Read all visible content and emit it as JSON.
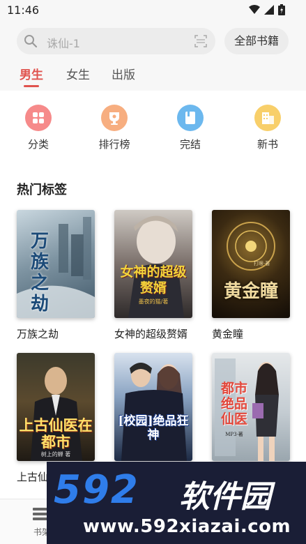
{
  "status_bar": {
    "time": "11:46"
  },
  "search": {
    "placeholder": "诛仙-1"
  },
  "header": {
    "all_books_label": "全部书籍"
  },
  "tabs": [
    {
      "label": "男生",
      "active": true
    },
    {
      "label": "女生",
      "active": false
    },
    {
      "label": "出版",
      "active": false
    }
  ],
  "categories": [
    {
      "label": "分类",
      "icon": "grid-icon",
      "color": "#f26b6b"
    },
    {
      "label": "排行榜",
      "icon": "trophy-icon",
      "color": "#f5a366"
    },
    {
      "label": "完结",
      "icon": "book-icon",
      "color": "#4aa3e8"
    },
    {
      "label": "新书",
      "icon": "building-icon",
      "color": "#f5c247"
    }
  ],
  "section": {
    "title": "热门标签"
  },
  "books": [
    {
      "title": "万族之劫",
      "cover_text": "万族之劫",
      "author_text": ""
    },
    {
      "title": "女神的超级赘婿",
      "cover_text": "女神的超级赘婿",
      "author_text": "墨夜的猫/著"
    },
    {
      "title": "黄金瞳",
      "cover_text": "黄金瞳",
      "author_text": "打眼·著"
    },
    {
      "title": "上古仙",
      "cover_text": "上古仙医在都市",
      "author_text": "树上的蝉 著"
    },
    {
      "title": "",
      "cover_text": "[校园]绝品狂神",
      "author_text": ""
    },
    {
      "title": "",
      "cover_text": "都市绝品仙医",
      "author_text": "MP3·著"
    }
  ],
  "bottom_nav": {
    "shelf_label": "书架"
  },
  "watermark": {
    "logo": "592",
    "name": "软件园",
    "url": "www.592xiazai.com"
  },
  "colors": {
    "accent": "#e0524d",
    "watermark_bg": "#1a1e36",
    "watermark_blue": "#2f7dea"
  }
}
